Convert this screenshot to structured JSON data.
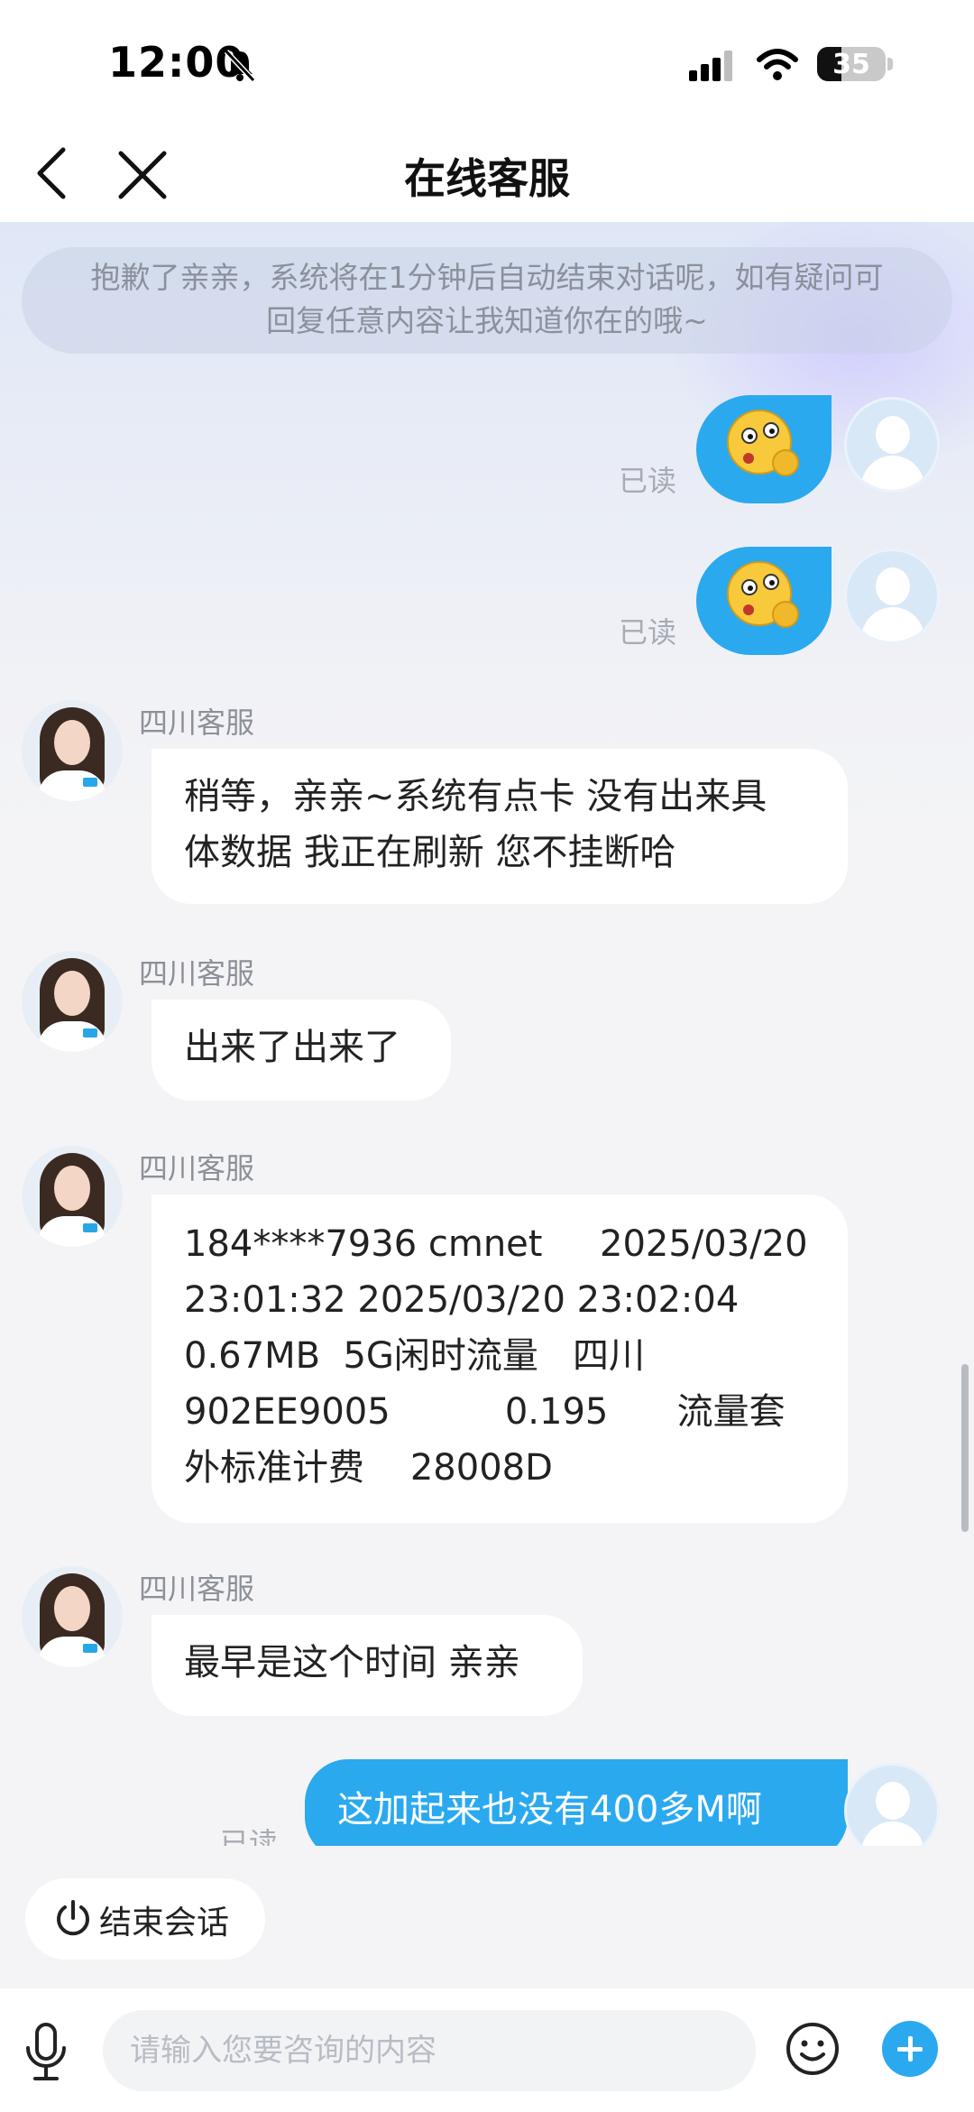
{
  "status_bar": {
    "time": "12:00",
    "battery_level": "35"
  },
  "nav": {
    "title": "在线客服"
  },
  "chat": {
    "notice_lines": [
      "抱歉了亲亲，系统将在1分钟后自动结束对话呢，如有疑问可",
      "回复任意内容让我知道你在的哦~"
    ],
    "read_label": "已读",
    "agent_name": "四川客服",
    "msg1_lines": [
      "稍等，亲亲~系统有点卡 没有出来具",
      "体数据 我正在刷新 您不挂断哈"
    ],
    "msg2": "出来了出来了",
    "msg3_lines": [
      "184****7936 cmnet     2025/03/20",
      "23:01:32 2025/03/20 23:02:04",
      "0.67MB  5G闲时流量   四川",
      "902EE9005          0.195      流量套",
      "外标准计费    28008D"
    ],
    "msg4": "最早是这个时间 亲亲",
    "user_msg": "这加起来也没有400多M啊",
    "user_emoji": "dizzy-face-emoji"
  },
  "end_session": {
    "label": "结束会话"
  },
  "composer": {
    "placeholder": "请输入您要咨询的内容"
  },
  "colors": {
    "accent": "#2aa9ef",
    "background": "#f4f4f6"
  }
}
